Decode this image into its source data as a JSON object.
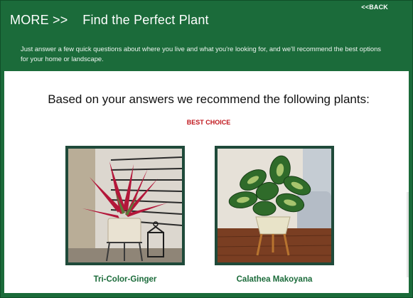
{
  "header": {
    "back_link": "<<BACK",
    "title_prefix": "MORE >>",
    "title": "Find the Perfect Plant",
    "intro": "Just answer a few quick questions about where you live and what you're looking for, and we'll recommend the best options for your home or landscape."
  },
  "results": {
    "heading": "Based on your answers we recommend the following plants:",
    "badge": "BEST CHOICE",
    "plants": [
      {
        "name": "Tri-Color-Ginger",
        "image_icon": "plant-photo"
      },
      {
        "name": "Calathea Makoyana",
        "image_icon": "plant-photo"
      }
    ]
  },
  "colors": {
    "brand_green": "#1b6b3a",
    "badge_red": "#c0161c",
    "photo_border": "#1f4a3a"
  }
}
